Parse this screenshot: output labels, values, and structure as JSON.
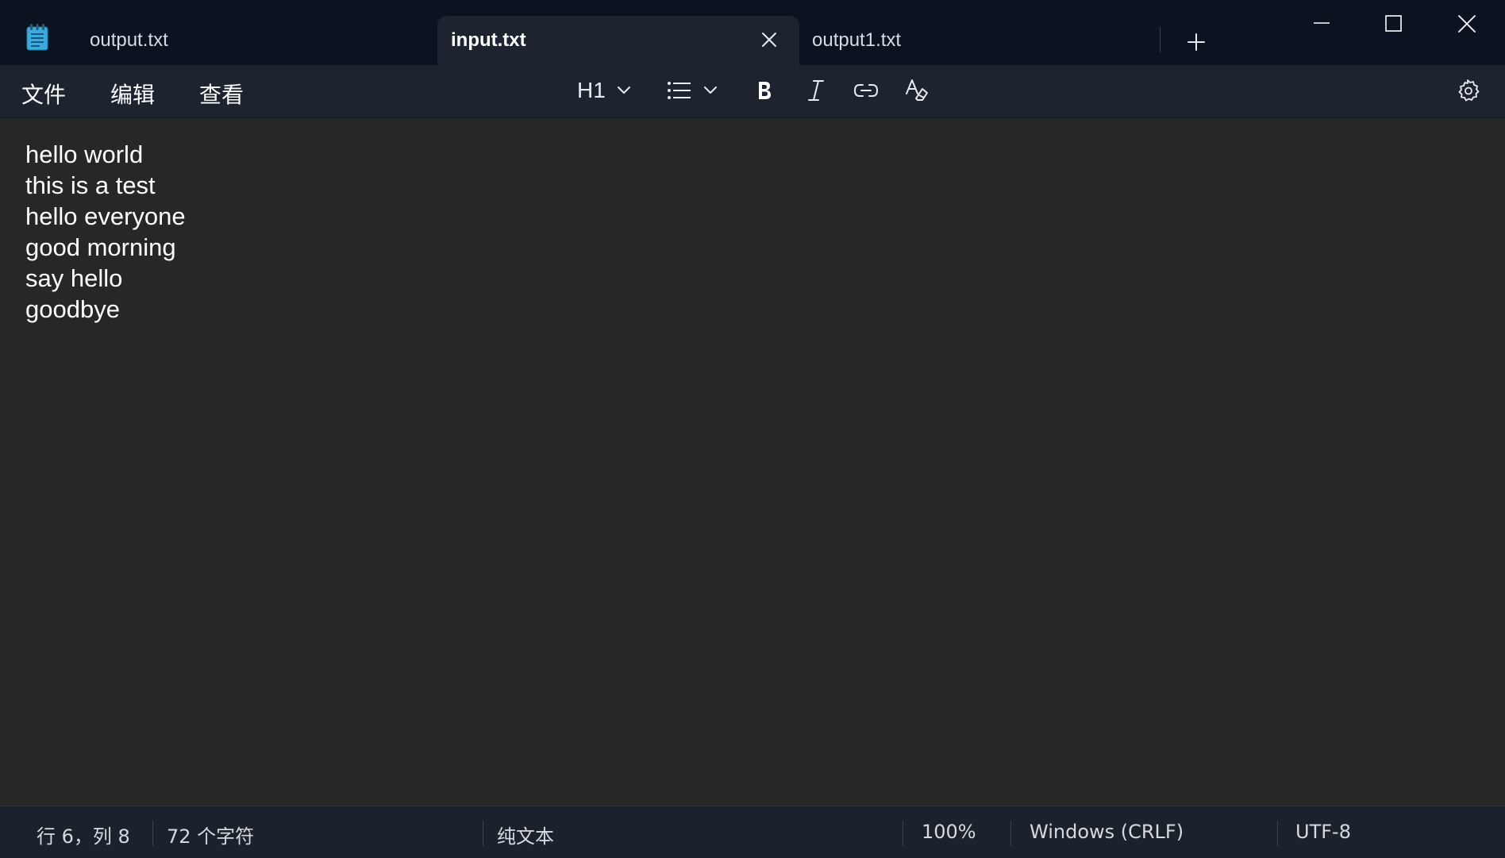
{
  "tabs": [
    {
      "label": "output.txt",
      "active": false
    },
    {
      "label": "input.txt",
      "active": true
    },
    {
      "label": "output1.txt",
      "active": false
    }
  ],
  "menu": [
    "文件",
    "编辑",
    "查看"
  ],
  "toolbar": {
    "heading_label": "H1",
    "icons": [
      "heading-dropdown",
      "list-icon",
      "bold-icon",
      "italic-icon",
      "link-icon",
      "clear-formatting-icon",
      "settings-icon"
    ]
  },
  "editor": {
    "lines": [
      "hello world",
      "this is a test",
      "hello everyone",
      "good morning",
      "say hello",
      "goodbye"
    ]
  },
  "status": {
    "position": "行 6，列 8",
    "char_count": "72 个字符",
    "format": "纯文本",
    "zoom": "100%",
    "line_ending": "Windows (CRLF)",
    "encoding": "UTF-8"
  },
  "colors": {
    "titlebar": "#0b1320",
    "active_tab": "#1d2430",
    "editor_bg": "#272727",
    "statusbar": "#1c222b",
    "notepad_icon": "#3da9dc"
  }
}
